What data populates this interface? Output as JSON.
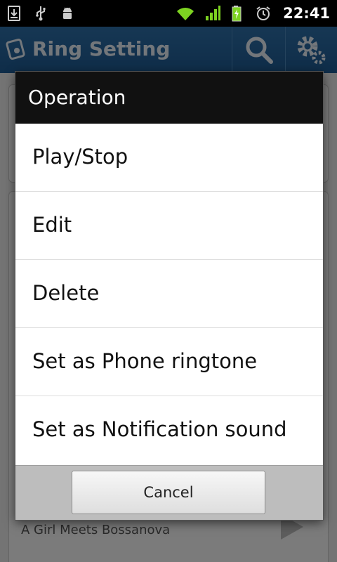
{
  "status_bar": {
    "time": "22:41",
    "icons_left": [
      "download-icon",
      "usb-icon",
      "android-debug-icon"
    ],
    "icons_right": [
      "wifi-icon",
      "signal-icon",
      "battery-charging-icon",
      "alarm-icon"
    ]
  },
  "app_header": {
    "title": "Ring Setting",
    "icons": [
      "ringtone-logo-icon",
      "search-icon",
      "gear-icon"
    ],
    "color": "#2d6fa8"
  },
  "background": {
    "partial_song_title": "A Girl Meets Bossanova"
  },
  "dialog": {
    "title": "Operation",
    "items": [
      {
        "label": "Play/Stop"
      },
      {
        "label": "Edit"
      },
      {
        "label": "Delete"
      },
      {
        "label": "Set as Phone ringtone"
      },
      {
        "label": "Set as Notification sound"
      }
    ],
    "cancel_label": "Cancel"
  }
}
